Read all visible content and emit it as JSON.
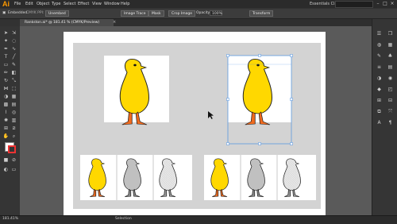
{
  "app": {
    "logo": "Ai",
    "workspace": "Essentials Classic"
  },
  "menu": [
    "File",
    "Edit",
    "Object",
    "Type",
    "Select",
    "Effect",
    "View",
    "Window",
    "Help"
  ],
  "control_bar": {
    "embedded": "Embedded",
    "color_info": "CMYK  PPI: 72",
    "unembed": "Unembed",
    "image_trace": "Image Trace",
    "mask": "Mask",
    "crop_image": "Crop Image",
    "opacity_label": "Opacity:",
    "opacity_value": "100%",
    "transform": "Transform"
  },
  "document_tab": {
    "title": "Rankston.ai* @ 181.41 % (CMYK/Preview)",
    "close": "×"
  },
  "status_bar": {
    "zoom": "181.41%",
    "mode": "Selection"
  },
  "icons": {
    "colors": {
      "chick": "#ffd800",
      "legs": "#f06a1e",
      "gray": "#c0c0c0",
      "selection": "#4a90e2",
      "accent": "#ff9a00"
    }
  }
}
